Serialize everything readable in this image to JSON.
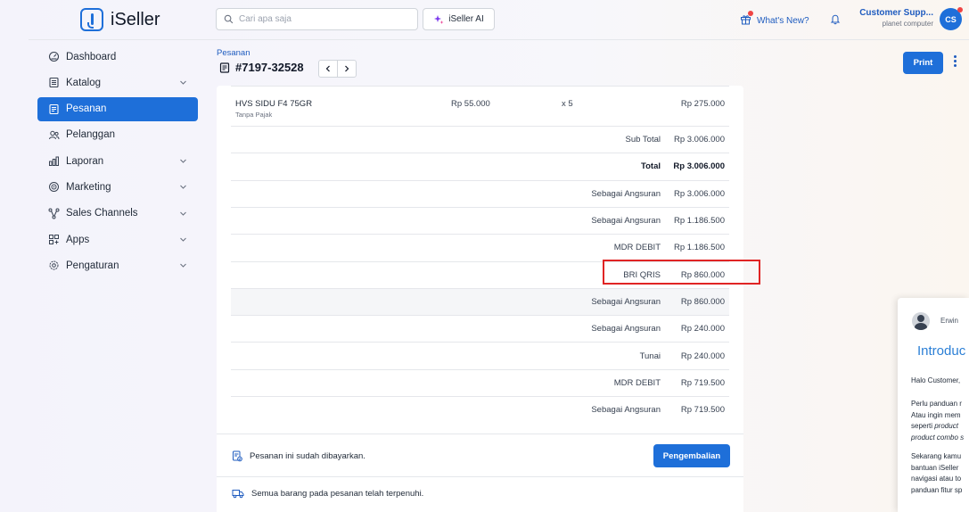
{
  "header": {
    "brand": "iSeller",
    "search_placeholder": "Cari apa saja",
    "ai_label": "iSeller AI",
    "whats_new": "What's New?",
    "user_name": "Customer Supp...",
    "user_sub": "planet computer",
    "avatar_initials": "CS"
  },
  "sidebar": {
    "items": [
      {
        "label": "Dashboard",
        "icon": "dashboard-icon"
      },
      {
        "label": "Katalog",
        "icon": "catalog-icon"
      },
      {
        "label": "Pesanan",
        "icon": "orders-icon"
      },
      {
        "label": "Pelanggan",
        "icon": "customers-icon"
      },
      {
        "label": "Laporan",
        "icon": "reports-icon"
      },
      {
        "label": "Marketing",
        "icon": "target-icon"
      },
      {
        "label": "Sales Channels",
        "icon": "channels-icon"
      },
      {
        "label": "Apps",
        "icon": "apps-icon"
      },
      {
        "label": "Pengaturan",
        "icon": "gear-icon"
      }
    ]
  },
  "page": {
    "breadcrumb": "Pesanan",
    "order_number": "#7197-32528",
    "print_label": "Print"
  },
  "product": {
    "name": "HVS SIDU F4 75GR",
    "tax": "Tanpa Pajak",
    "price": "Rp 55.000",
    "qty": "x 5",
    "total": "Rp 275.000"
  },
  "summary": [
    {
      "label": "Sub Total",
      "value": "Rp 3.006.000"
    },
    {
      "label": "Total",
      "value": "Rp 3.006.000"
    },
    {
      "label": "Sebagai Angsuran",
      "value": "Rp 3.006.000"
    },
    {
      "label": "Sebagai Angsuran",
      "value": "Rp 1.186.500"
    },
    {
      "label": "MDR DEBIT",
      "value": "Rp 1.186.500"
    },
    {
      "label": "BRI QRIS",
      "value": "Rp 860.000"
    },
    {
      "label": "Sebagai Angsuran",
      "value": "Rp 860.000"
    },
    {
      "label": "Sebagai Angsuran",
      "value": "Rp 240.000"
    },
    {
      "label": "Tunai",
      "value": "Rp 240.000"
    },
    {
      "label": "MDR DEBIT",
      "value": "Rp 719.500"
    },
    {
      "label": "Sebagai Angsuran",
      "value": "Rp 719.500"
    }
  ],
  "status": {
    "paid_text": "Pesanan ini sudah dibayarkan.",
    "refund_label": "Pengembalian",
    "fulfilled_text": "Semua barang pada pesanan telah terpenuhi."
  },
  "chat": {
    "sender": "Erwin",
    "title": "Introduc",
    "greeting": "Halo Customer,",
    "p1_line1": "Perlu panduan r",
    "p1_line2": "Atau ingin mem",
    "p1_line3_prefix": "seperti ",
    "p1_line3_italic": "product",
    "p1_line4_italic": "product combo s",
    "p2_line1": "Sekarang kamu",
    "p2_line2": "bantuan iSeller",
    "p2_line3": "navigasi atau to",
    "p2_line4": "panduan fitur sp"
  },
  "colors": {
    "accent": "#1e6fd9",
    "link": "#1e5bbf",
    "highlight": "#e02424"
  }
}
